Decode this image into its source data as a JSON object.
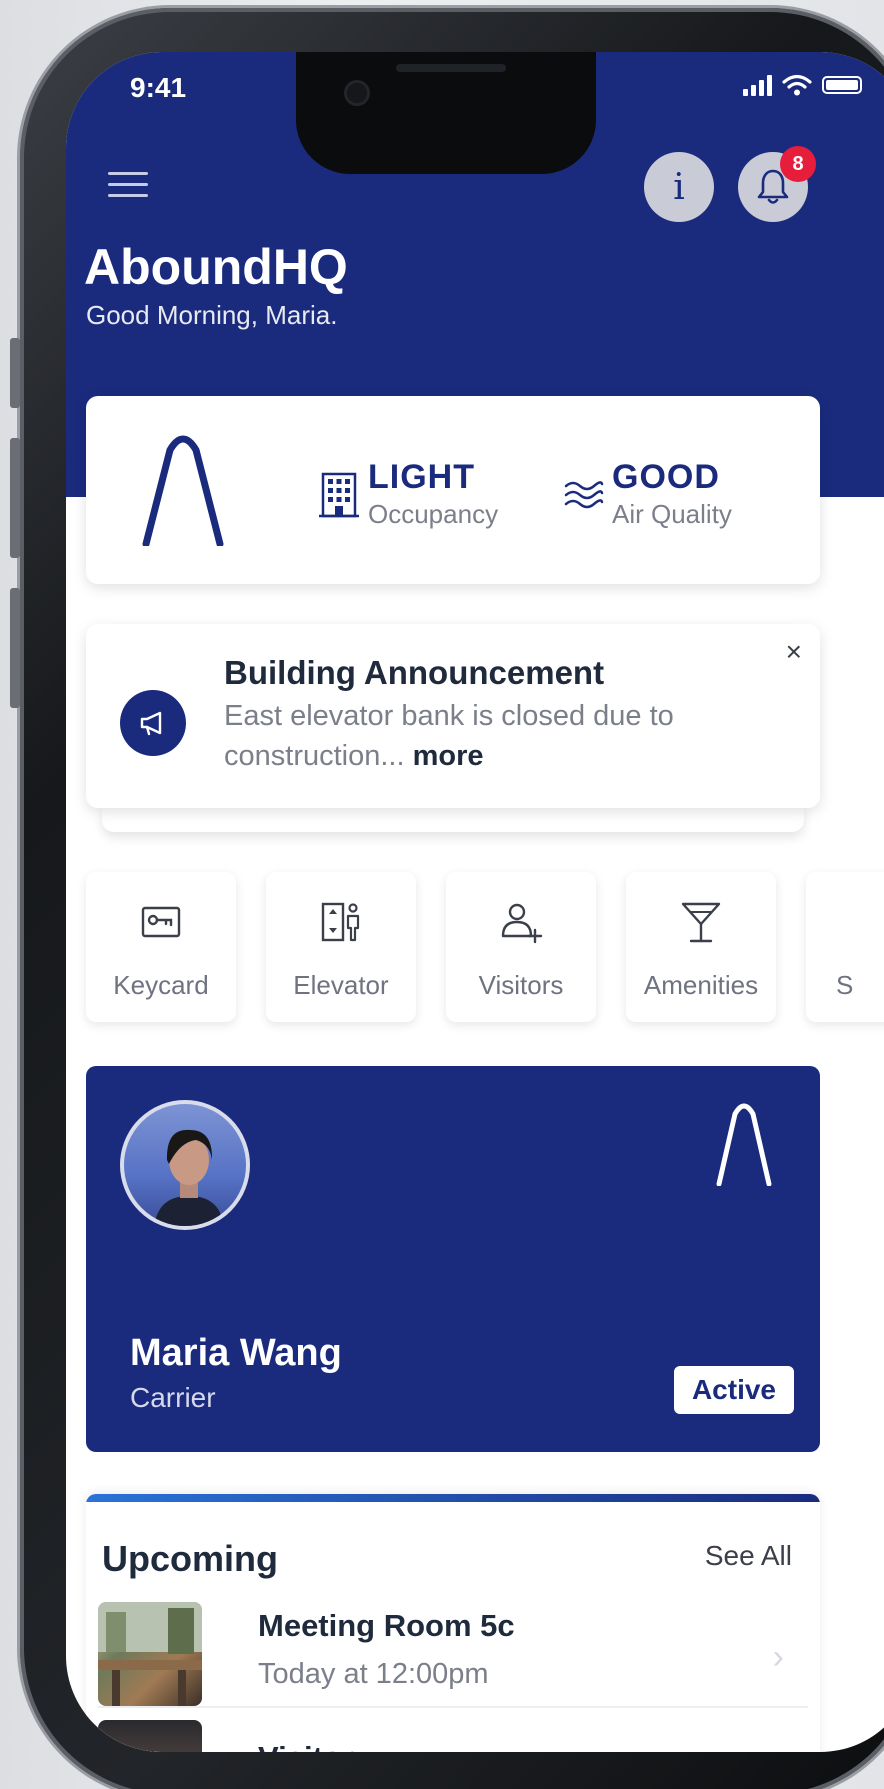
{
  "status_bar": {
    "time": "9:41"
  },
  "header": {
    "app_title": "AboundHQ",
    "greeting": "Good Morning, Maria.",
    "notification_count": "8",
    "info_glyph": "i"
  },
  "building_status": {
    "occupancy": {
      "value": "LIGHT",
      "label": "Occupancy",
      "icon": "building-icon"
    },
    "air_quality": {
      "value": "GOOD",
      "label": "Air Quality",
      "icon": "air-waves-icon"
    }
  },
  "announcement": {
    "title": "Building Announcement",
    "body": "East elevator bank is closed due to construction...",
    "more_label": "more",
    "close_glyph": "×"
  },
  "quick_actions": [
    {
      "label": "Keycard",
      "icon": "keycard-icon"
    },
    {
      "label": "Elevator",
      "icon": "elevator-icon"
    },
    {
      "label": "Visitors",
      "icon": "add-visitor-icon"
    },
    {
      "label": "Amenities",
      "icon": "cocktail-icon"
    },
    {
      "label": "S",
      "icon": "partial-icon"
    }
  ],
  "profile_card": {
    "name": "Maria Wang",
    "role": "Carrier",
    "status": "Active"
  },
  "upcoming": {
    "title": "Upcoming",
    "see_all_label": "See All",
    "items": [
      {
        "name": "Meeting Room 5c",
        "time": "Today at 12:00pm"
      },
      {
        "name": "Visitor"
      }
    ]
  },
  "colors": {
    "brand_navy": "#1a2b7e",
    "badge_red": "#e61e3c",
    "accent_blue": "#2a73d8"
  }
}
